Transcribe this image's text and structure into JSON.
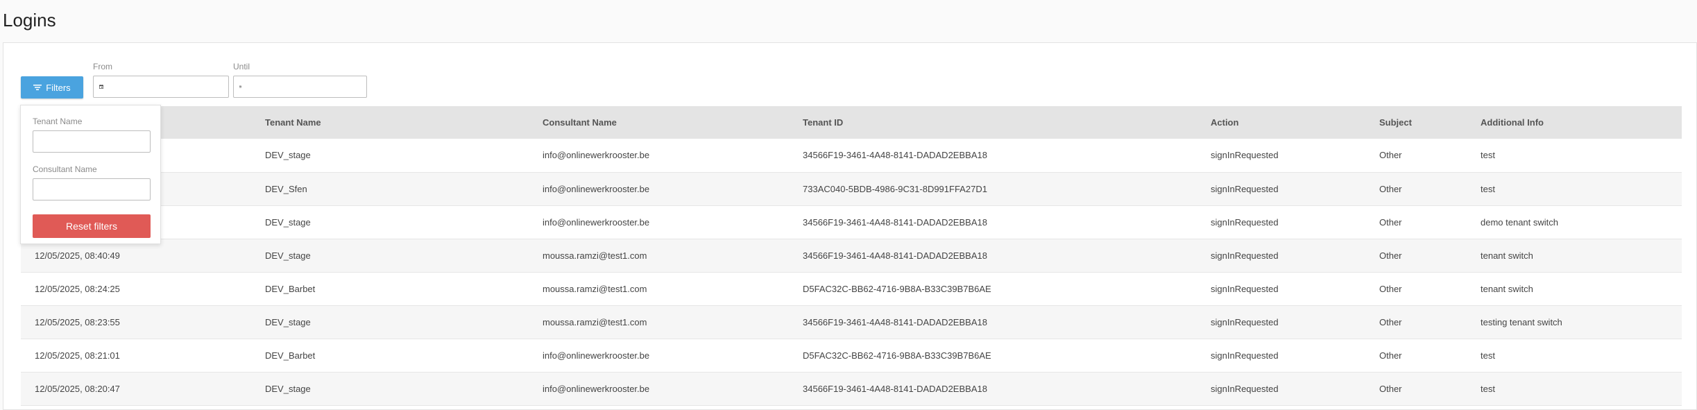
{
  "page": {
    "title": "Logins"
  },
  "toolbar": {
    "filters_label": "Filters",
    "from_label": "From",
    "until_label": "Until"
  },
  "colors": {
    "accent": "#4aa3df",
    "danger": "#e05a56",
    "header_bg": "#e4e4e4"
  },
  "icons": {
    "filters": "filter-lines-icon",
    "calendar": "calendar-icon"
  },
  "table": {
    "columns": [
      "",
      "Tenant Name",
      "Consultant Name",
      "Tenant ID",
      "Action",
      "Subject",
      "Additional Info"
    ],
    "rows": [
      [
        "",
        "DEV_stage",
        "info@onlinewerkrooster.be",
        "34566F19-3461-4A48-8141-DADAD2EBBA18",
        "signInRequested",
        "Other",
        "test"
      ],
      [
        "",
        "DEV_Sfen",
        "info@onlinewerkrooster.be",
        "733AC040-5BDB-4986-9C31-8D991FFA27D1",
        "signInRequested",
        "Other",
        "test"
      ],
      [
        "",
        "DEV_stage",
        "info@onlinewerkrooster.be",
        "34566F19-3461-4A48-8141-DADAD2EBBA18",
        "signInRequested",
        "Other",
        "demo tenant switch"
      ],
      [
        "12/05/2025, 08:40:49",
        "DEV_stage",
        "moussa.ramzi@test1.com",
        "34566F19-3461-4A48-8141-DADAD2EBBA18",
        "signInRequested",
        "Other",
        "tenant switch"
      ],
      [
        "12/05/2025, 08:24:25",
        "DEV_Barbet",
        "moussa.ramzi@test1.com",
        "D5FAC32C-BB62-4716-9B8A-B33C39B7B6AE",
        "signInRequested",
        "Other",
        "tenant switch"
      ],
      [
        "12/05/2025, 08:23:55",
        "DEV_stage",
        "moussa.ramzi@test1.com",
        "34566F19-3461-4A48-8141-DADAD2EBBA18",
        "signInRequested",
        "Other",
        "testing tenant switch"
      ],
      [
        "12/05/2025, 08:21:01",
        "DEV_Barbet",
        "info@onlinewerkrooster.be",
        "D5FAC32C-BB62-4716-9B8A-B33C39B7B6AE",
        "signInRequested",
        "Other",
        "test"
      ],
      [
        "12/05/2025, 08:20:47",
        "DEV_stage",
        "info@onlinewerkrooster.be",
        "34566F19-3461-4A48-8141-DADAD2EBBA18",
        "signInRequested",
        "Other",
        "test"
      ]
    ]
  },
  "filter_panel": {
    "tenant_name_label": "Tenant Name",
    "tenant_name_value": "",
    "consultant_name_label": "Consultant Name",
    "consultant_name_value": "",
    "reset_label": "Reset filters"
  }
}
